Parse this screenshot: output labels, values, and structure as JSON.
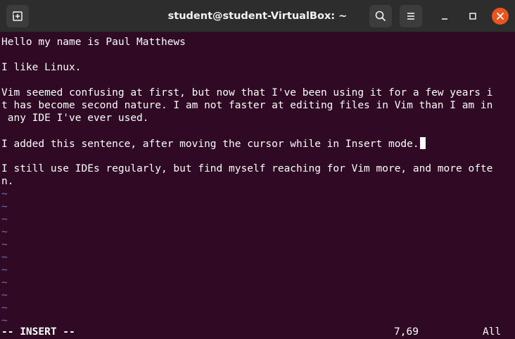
{
  "window": {
    "title": "student@student-VirtualBox: ~"
  },
  "titlebar": {
    "new_tab_icon": "new-tab-icon",
    "search_icon": "search-icon",
    "menu_icon": "hamburger-menu-icon",
    "minimize_icon": "minimize-icon",
    "maximize_icon": "maximize-icon",
    "close_icon": "close-icon",
    "close_color": "#e95420"
  },
  "editor": {
    "lines": [
      "Hello my name is Paul Matthews",
      "",
      "I like Linux.",
      "",
      "Vim seemed confusing at first, but now that I've been using it for a few years i",
      "t has become second nature. I am not faster at editing files in Vim than I am in",
      " any IDE I've ever used.",
      "",
      "I added this sentence, after moving the cursor while in Insert mode.",
      "",
      "I still use IDEs regularly, but find myself reaching for Vim more, and more ofte",
      "n."
    ],
    "tilde": "~",
    "empty_line_count": 11,
    "tilde_color": "#6c6fbd",
    "background_color": "#300a24"
  },
  "statusbar": {
    "mode": "-- INSERT --",
    "position": "7,69",
    "scroll": "All"
  }
}
